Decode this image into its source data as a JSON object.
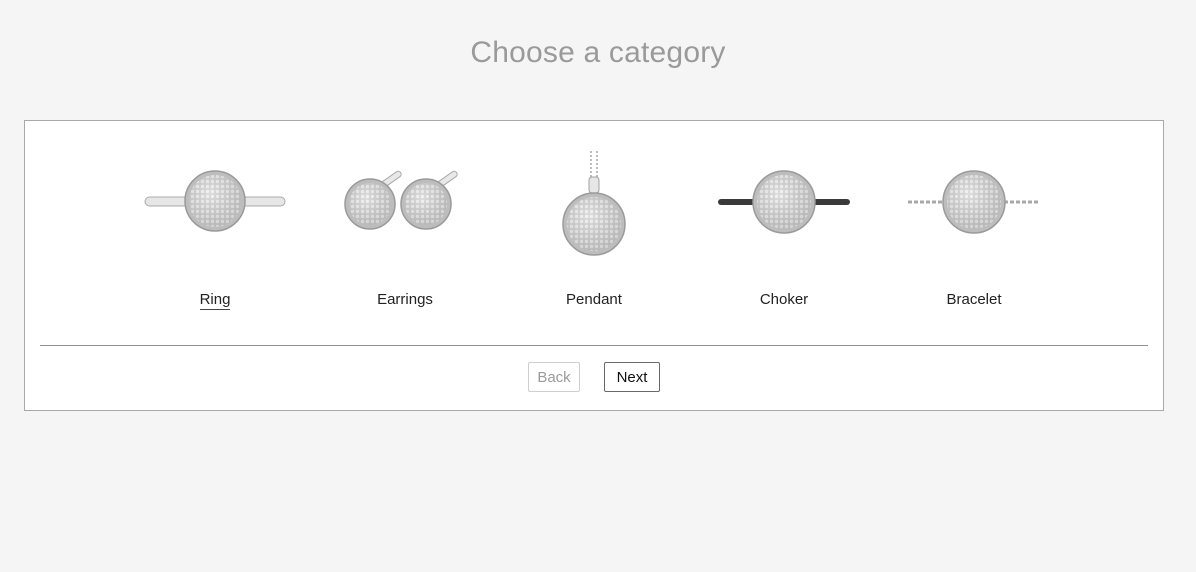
{
  "header": {
    "title": "Choose a category"
  },
  "categories": [
    {
      "label": "Ring",
      "icon": "ring-icon",
      "selected": true
    },
    {
      "label": "Earrings",
      "icon": "earrings-icon",
      "selected": false
    },
    {
      "label": "Pendant",
      "icon": "pendant-icon",
      "selected": false
    },
    {
      "label": "Choker",
      "icon": "choker-icon",
      "selected": false
    },
    {
      "label": "Bracelet",
      "icon": "bracelet-icon",
      "selected": false
    }
  ],
  "footer": {
    "back_label": "Back",
    "next_label": "Next"
  },
  "colors": {
    "background": "#f5f5f5",
    "title": "#9a9a9a",
    "panel_border": "#a8a8a8",
    "disabled_text": "#9a9a9a"
  }
}
